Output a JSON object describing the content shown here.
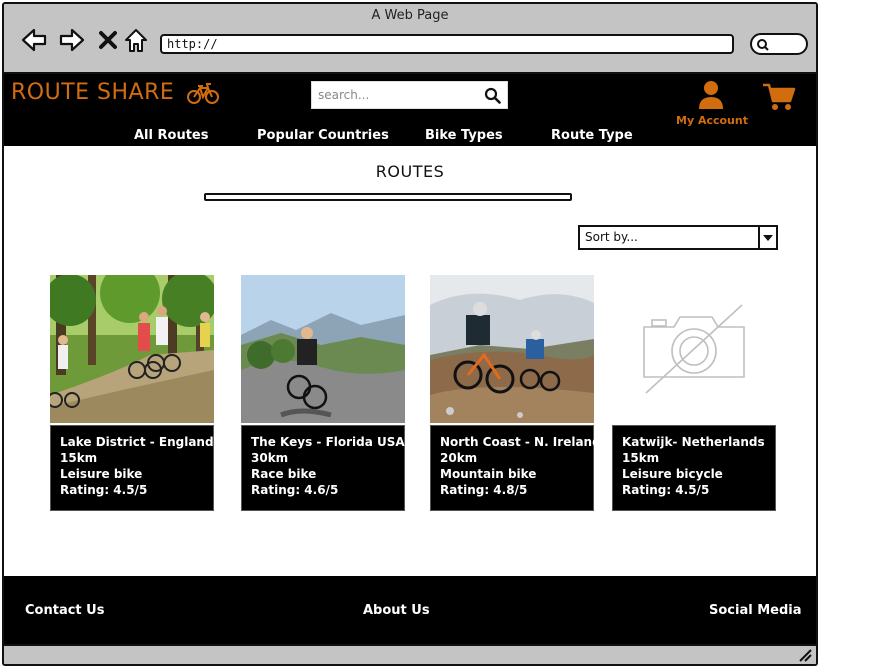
{
  "window": {
    "title": "A Web Page"
  },
  "browser": {
    "url": "http://"
  },
  "header": {
    "logo": "ROUTE SHARE",
    "search_placeholder": "search...",
    "account_label": "My Account",
    "nav": [
      "All Routes",
      "Popular Countries",
      "Bike Types",
      "Route Type"
    ]
  },
  "main": {
    "title": "ROUTES",
    "sort_label": "Sort by..."
  },
  "routes": [
    {
      "name": "Lake District - England",
      "distance": "15km",
      "bike": "Leisure bike",
      "rating": "Rating: 4.5/5"
    },
    {
      "name": "The Keys -  Florida USA",
      "distance": "30km",
      "bike": "Race bike",
      "rating": "Rating: 4.6/5"
    },
    {
      "name": "North Coast - N. Ireland",
      "distance": "20km",
      "bike": "Mountain bike",
      "rating": "Rating: 4.8/5"
    },
    {
      "name": "Katwijk- Netherlands",
      "distance": "15km",
      "bike": "Leisure bicycle",
      "rating": "Rating: 4.5/5"
    }
  ],
  "footer": {
    "contact": "Contact Us",
    "about": "About Us",
    "social": "Social Media"
  },
  "colors": {
    "accent": "#d26d0f",
    "header_bg": "#000000",
    "chrome": "#c4c4c4"
  }
}
